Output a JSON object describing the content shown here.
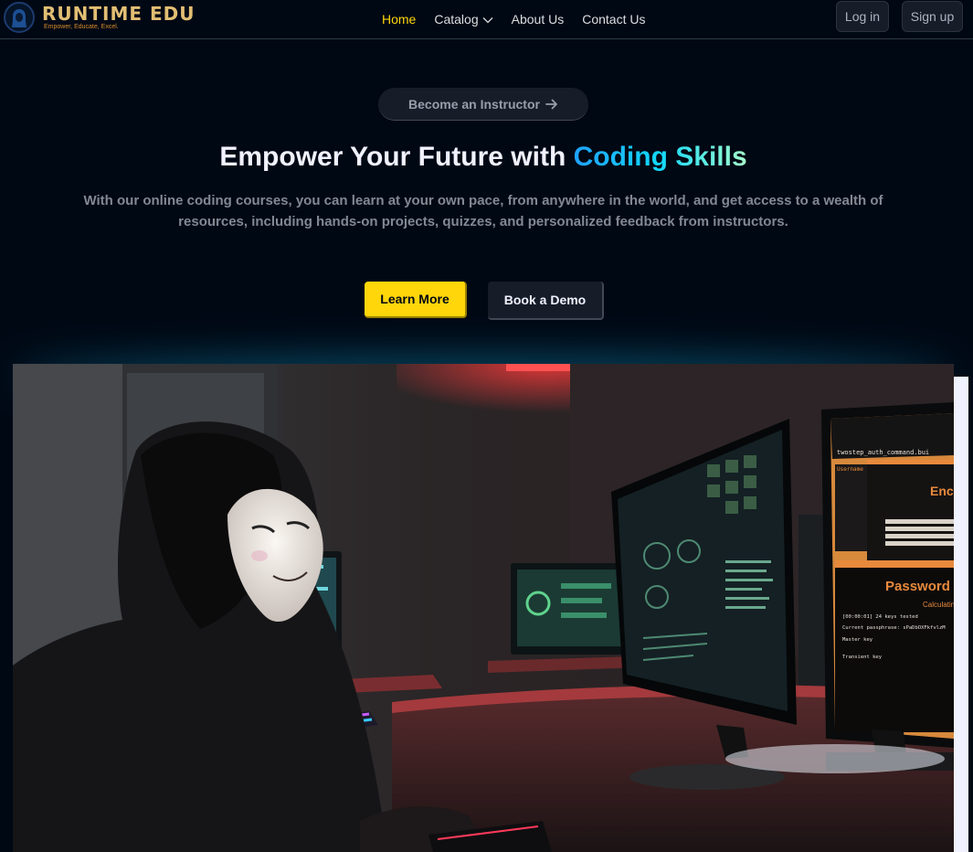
{
  "brand": {
    "name": "RUNTIME EDU",
    "tagline": "Empower, Educate, Excel."
  },
  "nav": {
    "links": [
      {
        "label": "Home",
        "active": true
      },
      {
        "label": "Catalog",
        "dropdown": true
      },
      {
        "label": "About Us"
      },
      {
        "label": "Contact Us"
      }
    ],
    "login_label": "Log in",
    "signup_label": "Sign up"
  },
  "hero": {
    "instructor_label": "Become an Instructor",
    "title_prefix": "Empower Your Future with ",
    "title_highlight": "Coding Skills",
    "description": "With our online coding courses, you can learn at your own pace, from anywhere in the world, and get access to a wealth of resources, including hands-on projects, quizzes, and personalized feedback from instructors.",
    "learn_more_label": "Learn More",
    "book_demo_label": "Book a Demo"
  },
  "screen_text": {
    "command": "twostep_auth_command.bui",
    "username": "Username",
    "username_password": "Username\nPassword",
    "enc": "Enc",
    "password": "Password",
    "calculating": "Calculatin",
    "keys_tested": "[00:00:01] 24 keys tested",
    "current_passphrase": "Current passphrase: sPaDbOXFkfvlzM",
    "master_key": "Master key",
    "transient_key": "Transient key"
  },
  "colors": {
    "background": "#000814",
    "accent_yellow": "#ffd60a",
    "button_dark": "#161d29",
    "highlight_gradient": [
      "#1fa2ff",
      "#12d8fa",
      "#a6ffcb"
    ]
  },
  "icons": {
    "logo": "hacker-logo-icon",
    "catalog": "chevron-down-icon",
    "instructor": "arrow-right-icon"
  }
}
